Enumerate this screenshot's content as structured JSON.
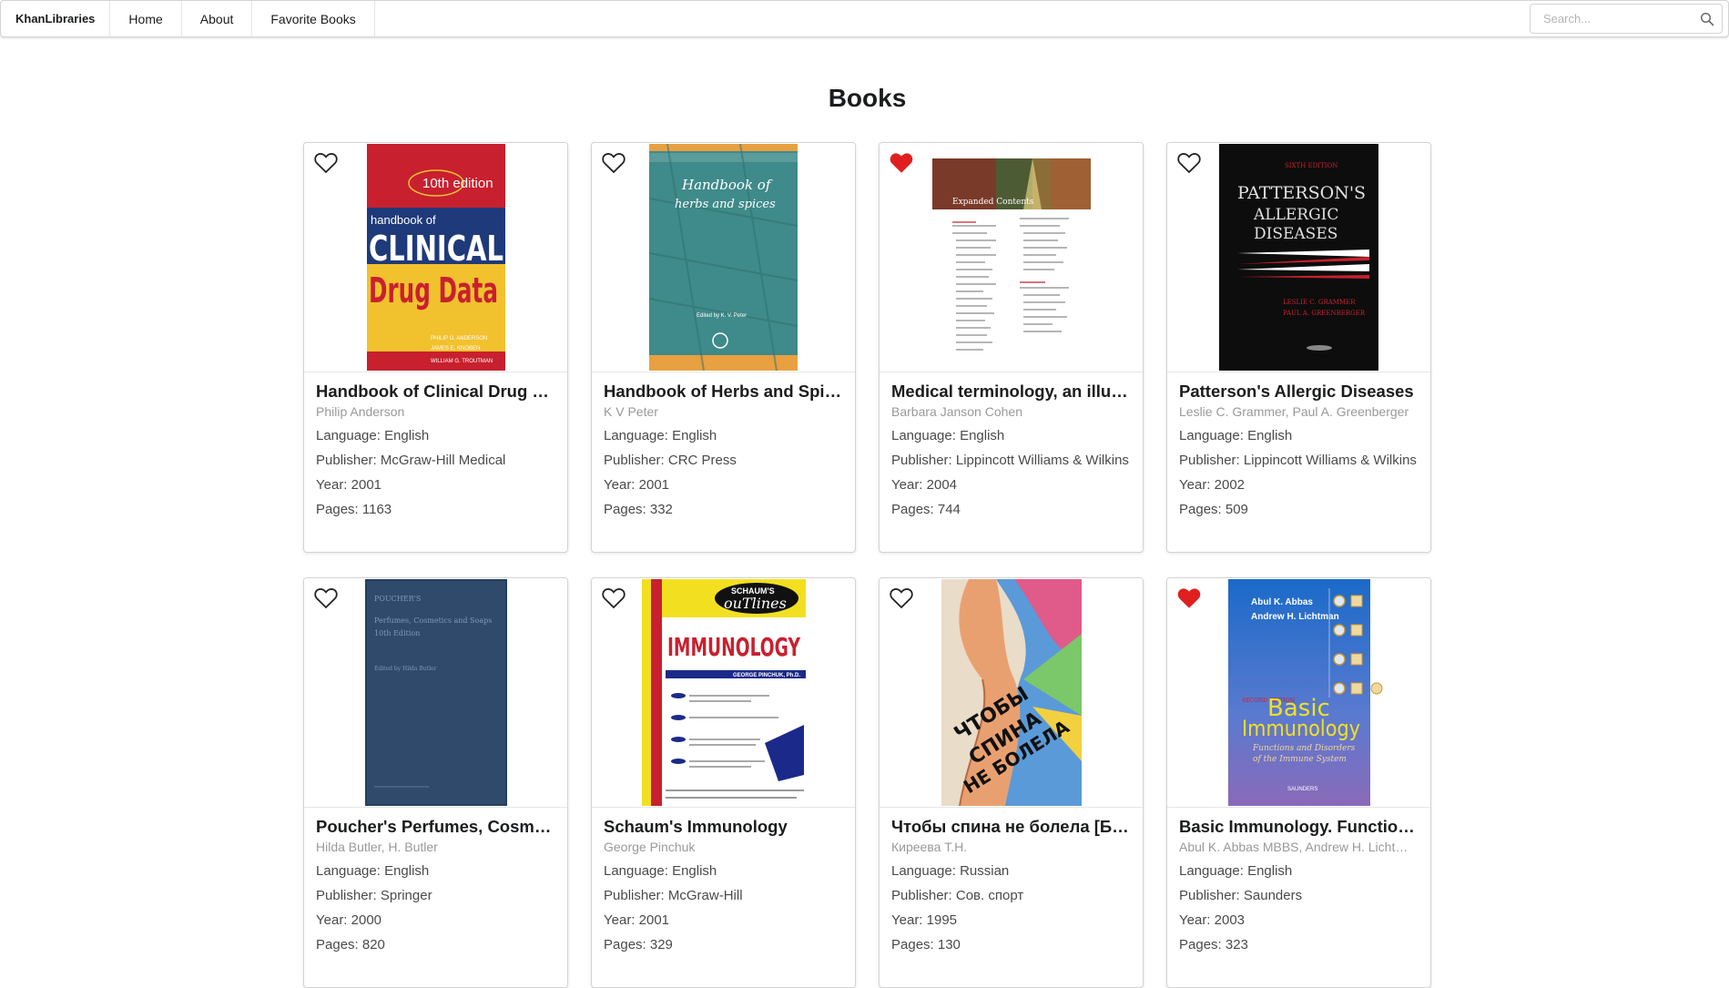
{
  "nav": {
    "brand": "KhanLibraries",
    "links": [
      "Home",
      "About",
      "Favorite Books"
    ],
    "search_placeholder": "Search..."
  },
  "page": {
    "title": "Books"
  },
  "labels": {
    "language": "Language: ",
    "publisher": "Publisher: ",
    "year": "Year: ",
    "pages": "Pages: "
  },
  "colors": {
    "heart_favorite": "#e02020",
    "heart_outline": "#222222",
    "border": "#d4d4d5"
  },
  "books": [
    {
      "title": "Handbook of Clinical Drug Data",
      "authors": "Philip Anderson",
      "language": "English",
      "publisher": "McGraw-Hill Medical",
      "year": "2001",
      "pages": "1163",
      "favorite": false,
      "cover_text": [
        "10th edition",
        "handbook of",
        "CLINICAL",
        "Drug Data",
        "PHILIP O. ANDERSON",
        "JAMES E. KNOBEN",
        "WILLIAM G. TROUTMAN"
      ],
      "cover_colors": {
        "top": "#c8202e",
        "mid": "#1f3a7a",
        "bottom": "#f2c12e"
      }
    },
    {
      "title": "Handbook of Herbs and Spices",
      "authors": "K V Peter",
      "language": "English",
      "publisher": "CRC Press",
      "year": "2001",
      "pages": "332",
      "favorite": false,
      "cover_text": [
        "Handbook of",
        "herbs and spices",
        "Edited by K. V. Peter"
      ],
      "cover_colors": {
        "main": "#3f8a8a",
        "band": "#e8a040"
      }
    },
    {
      "title": "Medical terminology, an illustrated guide",
      "authors": "Barbara Janson Cohen",
      "language": "English",
      "publisher": "Lippincott Williams & Wilkins",
      "year": "2004",
      "pages": "744",
      "favorite": true,
      "cover_text": [
        "Expanded Contents"
      ],
      "cover_colors": {
        "header": "#7a3a2a"
      }
    },
    {
      "title": "Patterson's Allergic Diseases",
      "authors": "Leslie C. Grammer, Paul A. Greenberger",
      "language": "English",
      "publisher": "Lippincott Williams & Wilkins",
      "year": "2002",
      "pages": "509",
      "favorite": false,
      "cover_text": [
        "SIXTH EDITION",
        "PATTERSON'S",
        "ALLERGIC",
        "DISEASES",
        "LESLIE C. GRAMMER",
        "PAUL A. GREENBERGER"
      ],
      "cover_colors": {
        "main": "#0d0d0d",
        "accent": "#c8202e"
      }
    },
    {
      "title": "Poucher's Perfumes, Cosmetics and Soaps",
      "authors": "Hilda Butler, H. Butler",
      "language": "English",
      "publisher": "Springer",
      "year": "2000",
      "pages": "820",
      "favorite": false,
      "cover_text": [
        "POUCHER'S",
        "Perfumes, Cosmetics and Soaps",
        "10th Edition",
        "Edited by Hilda Butler"
      ],
      "cover_colors": {
        "main": "#2f4a6a"
      }
    },
    {
      "title": "Schaum's Immunology",
      "authors": "George Pinchuk",
      "language": "English",
      "publisher": "McGraw-Hill",
      "year": "2001",
      "pages": "329",
      "favorite": false,
      "cover_text": [
        "SCHAUM'S",
        "ouTlines",
        "IMMUNOLOGY",
        "GEORGE PINCHUK, Ph.D."
      ],
      "cover_colors": {
        "main": "#f2e020",
        "accent": "#c8202e",
        "stripe": "#1b2a8a"
      }
    },
    {
      "title": "Чтобы спина не болела [Болезни позвоночника]",
      "authors": "Киреева Т.Н.",
      "language": "Russian",
      "publisher": "Сов. спорт",
      "year": "1995",
      "pages": "130",
      "favorite": false,
      "cover_text": [
        "ЧТОБЫ",
        "СПИНА",
        "НЕ БОЛЕЛА"
      ],
      "cover_colors": {
        "main": "#e9a070"
      }
    },
    {
      "title": "Basic Immunology. Functions and Disorders of the Immune System",
      "authors": "Abul K. Abbas MBBS, Andrew H. Lichtman",
      "language": "English",
      "publisher": "Saunders",
      "year": "2003",
      "pages": "323",
      "favorite": true,
      "cover_text": [
        "Abul K. Abbas",
        "Andrew H. Lichtman",
        "SECOND EDITION",
        "Basic",
        "Immunology",
        "Functions and Disorders",
        "of the Immune System",
        "SAUNDERS"
      ],
      "cover_colors": {
        "top": "#1a6ac8",
        "bottom": "#8a6ab8"
      }
    }
  ]
}
